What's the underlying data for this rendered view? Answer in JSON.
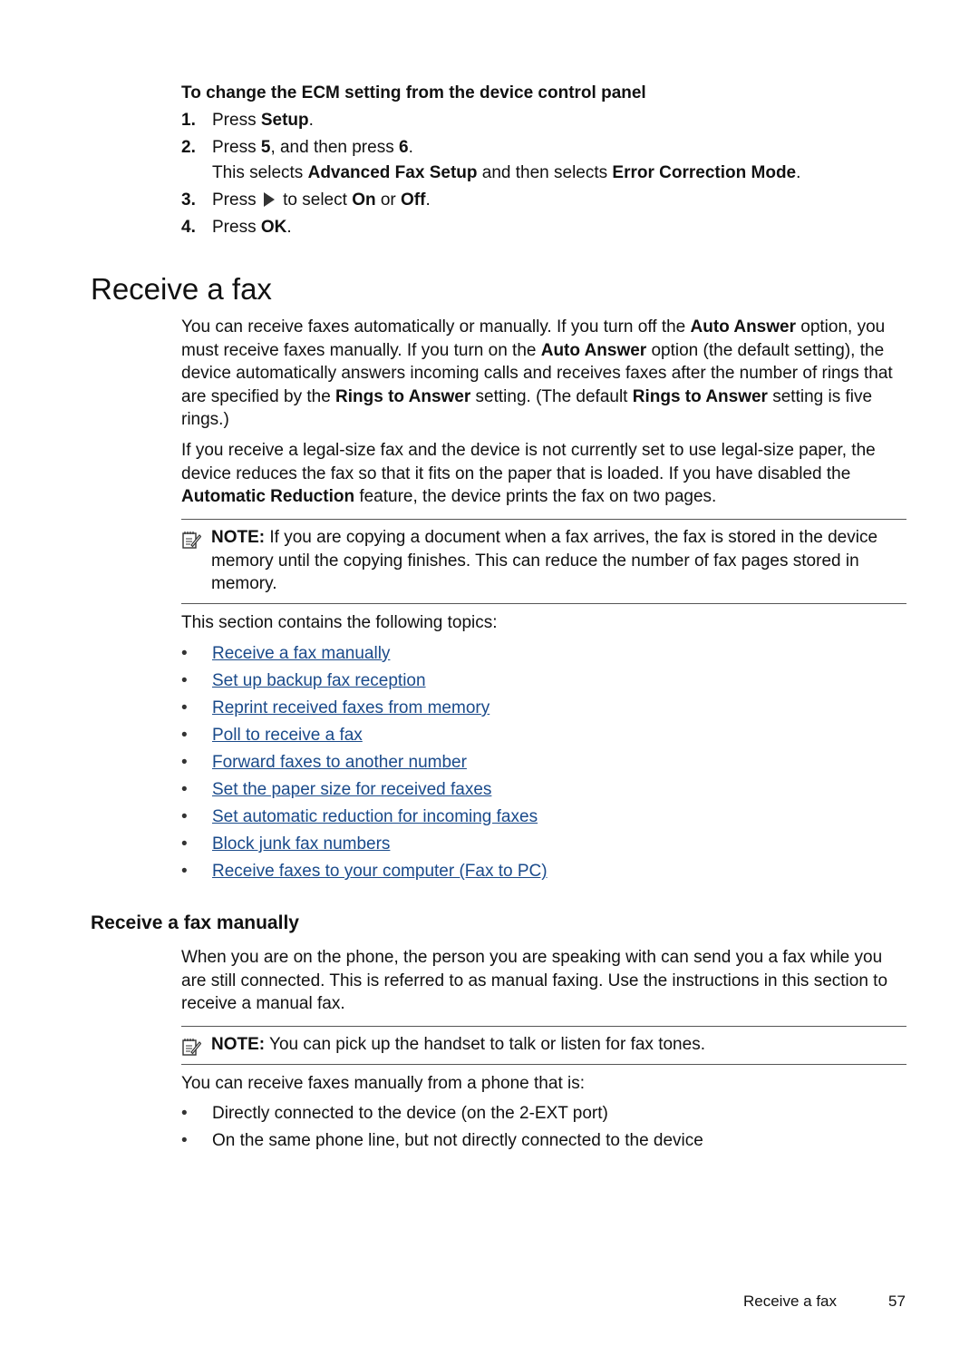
{
  "procedure": {
    "title": "To change the ECM setting from the device control panel",
    "steps": [
      {
        "num": "1.",
        "pre": "Press ",
        "b1": "Setup",
        "post": "."
      },
      {
        "num": "2.",
        "pre": "Press ",
        "b1": "5",
        "mid": ", and then press ",
        "b2": "6",
        "post": "."
      },
      {
        "num": "3.",
        "pre": "Press ",
        "mid": " to select ",
        "b1": "On",
        "mid2": " or ",
        "b2": "Off",
        "post": ".",
        "icon": "right-arrow-button-icon"
      },
      {
        "num": "4.",
        "pre": "Press ",
        "b1": "OK",
        "post": "."
      }
    ],
    "step2_detail": {
      "pre": "This selects ",
      "b1": "Advanced Fax Setup",
      "mid": " and then selects ",
      "b2": "Error Correction Mode",
      "post": "."
    }
  },
  "section": {
    "title": "Receive a fax",
    "p1": [
      "You can receive faxes automatically or manually. If you turn off the ",
      "Auto Answer",
      " option, you must receive faxes manually. If you turn on the ",
      "Auto Answer",
      " option (the default setting), the device automatically answers incoming calls and receives faxes after the number of rings that are specified by the ",
      "Rings to Answer",
      " setting. (The default ",
      "Rings to Answer",
      " setting is five rings.)"
    ],
    "p2": [
      "If you receive a legal-size fax and the device is not currently set to use legal-size paper, the device reduces the fax so that it fits on the paper that is loaded. If you have disabled the ",
      "Automatic Reduction",
      " feature, the device prints the fax on two pages."
    ],
    "note1": {
      "label": "NOTE:",
      "text": "  If you are copying a document when a fax arrives, the fax is stored in the device memory until the copying finishes. This can reduce the number of fax pages stored in memory."
    },
    "topics_intro": "This section contains the following topics:",
    "bullet": "•",
    "topics": [
      "Receive a fax manually",
      "Set up backup fax reception",
      "Reprint received faxes from memory",
      "Poll to receive a fax",
      "Forward faxes to another number",
      "Set the paper size for received faxes",
      "Set automatic reduction for incoming faxes",
      "Block junk fax numbers",
      "Receive faxes to your computer (Fax to PC)"
    ],
    "link_color": "#1a4a8a"
  },
  "subsection": {
    "title": "Receive a fax manually",
    "p1": "When you are on the phone, the person you are speaking with can send you a fax while you are still connected. This is referred to as manual faxing. Use the instructions in this section to receive a manual fax.",
    "note": {
      "label": "NOTE:",
      "text": "  You can pick up the handset to talk or listen for fax tones."
    },
    "p2": "You can receive faxes manually from a phone that is:",
    "items": [
      "Directly connected to the device (on the 2-EXT port)",
      "On the same phone line, but not directly connected to the device"
    ]
  },
  "footer": {
    "section": "Receive a fax",
    "page": "57"
  }
}
